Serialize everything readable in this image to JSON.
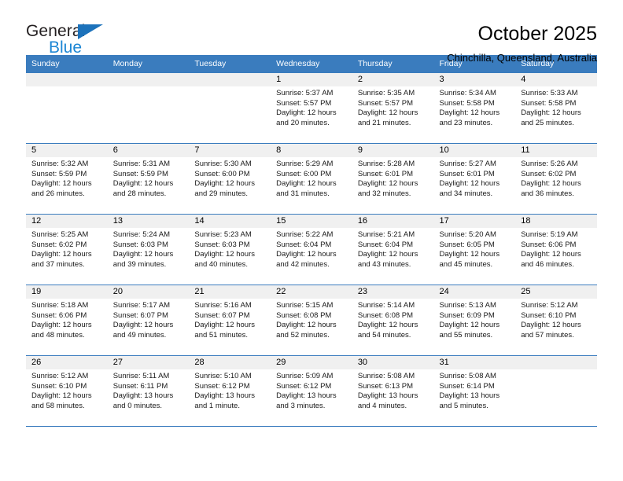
{
  "brand": {
    "name_top": "General",
    "name_bottom": "Blue",
    "color_dark": "#231f20",
    "color_blue": "#1c86d4",
    "triangle_color": "#1c72bb"
  },
  "header": {
    "title": "October 2025",
    "subtitle": "Chinchilla, Queensland, Australia"
  },
  "theme": {
    "header_row_bg": "#3a7cbe",
    "header_row_fg": "#ffffff",
    "daynum_band_bg": "#f0f0f0",
    "grid_line": "#3a7cbe"
  },
  "weekdays": [
    "Sunday",
    "Monday",
    "Tuesday",
    "Wednesday",
    "Thursday",
    "Friday",
    "Saturday"
  ],
  "weeks": [
    [
      {
        "day": "",
        "sunrise": "",
        "sunset": "",
        "daylight1": "",
        "daylight2": "",
        "empty": true
      },
      {
        "day": "",
        "sunrise": "",
        "sunset": "",
        "daylight1": "",
        "daylight2": "",
        "empty": true
      },
      {
        "day": "",
        "sunrise": "",
        "sunset": "",
        "daylight1": "",
        "daylight2": "",
        "empty": true
      },
      {
        "day": "1",
        "sunrise": "Sunrise: 5:37 AM",
        "sunset": "Sunset: 5:57 PM",
        "daylight1": "Daylight: 12 hours",
        "daylight2": "and 20 minutes."
      },
      {
        "day": "2",
        "sunrise": "Sunrise: 5:35 AM",
        "sunset": "Sunset: 5:57 PM",
        "daylight1": "Daylight: 12 hours",
        "daylight2": "and 21 minutes."
      },
      {
        "day": "3",
        "sunrise": "Sunrise: 5:34 AM",
        "sunset": "Sunset: 5:58 PM",
        "daylight1": "Daylight: 12 hours",
        "daylight2": "and 23 minutes."
      },
      {
        "day": "4",
        "sunrise": "Sunrise: 5:33 AM",
        "sunset": "Sunset: 5:58 PM",
        "daylight1": "Daylight: 12 hours",
        "daylight2": "and 25 minutes."
      }
    ],
    [
      {
        "day": "5",
        "sunrise": "Sunrise: 5:32 AM",
        "sunset": "Sunset: 5:59 PM",
        "daylight1": "Daylight: 12 hours",
        "daylight2": "and 26 minutes."
      },
      {
        "day": "6",
        "sunrise": "Sunrise: 5:31 AM",
        "sunset": "Sunset: 5:59 PM",
        "daylight1": "Daylight: 12 hours",
        "daylight2": "and 28 minutes."
      },
      {
        "day": "7",
        "sunrise": "Sunrise: 5:30 AM",
        "sunset": "Sunset: 6:00 PM",
        "daylight1": "Daylight: 12 hours",
        "daylight2": "and 29 minutes."
      },
      {
        "day": "8",
        "sunrise": "Sunrise: 5:29 AM",
        "sunset": "Sunset: 6:00 PM",
        "daylight1": "Daylight: 12 hours",
        "daylight2": "and 31 minutes."
      },
      {
        "day": "9",
        "sunrise": "Sunrise: 5:28 AM",
        "sunset": "Sunset: 6:01 PM",
        "daylight1": "Daylight: 12 hours",
        "daylight2": "and 32 minutes."
      },
      {
        "day": "10",
        "sunrise": "Sunrise: 5:27 AM",
        "sunset": "Sunset: 6:01 PM",
        "daylight1": "Daylight: 12 hours",
        "daylight2": "and 34 minutes."
      },
      {
        "day": "11",
        "sunrise": "Sunrise: 5:26 AM",
        "sunset": "Sunset: 6:02 PM",
        "daylight1": "Daylight: 12 hours",
        "daylight2": "and 36 minutes."
      }
    ],
    [
      {
        "day": "12",
        "sunrise": "Sunrise: 5:25 AM",
        "sunset": "Sunset: 6:02 PM",
        "daylight1": "Daylight: 12 hours",
        "daylight2": "and 37 minutes."
      },
      {
        "day": "13",
        "sunrise": "Sunrise: 5:24 AM",
        "sunset": "Sunset: 6:03 PM",
        "daylight1": "Daylight: 12 hours",
        "daylight2": "and 39 minutes."
      },
      {
        "day": "14",
        "sunrise": "Sunrise: 5:23 AM",
        "sunset": "Sunset: 6:03 PM",
        "daylight1": "Daylight: 12 hours",
        "daylight2": "and 40 minutes."
      },
      {
        "day": "15",
        "sunrise": "Sunrise: 5:22 AM",
        "sunset": "Sunset: 6:04 PM",
        "daylight1": "Daylight: 12 hours",
        "daylight2": "and 42 minutes."
      },
      {
        "day": "16",
        "sunrise": "Sunrise: 5:21 AM",
        "sunset": "Sunset: 6:04 PM",
        "daylight1": "Daylight: 12 hours",
        "daylight2": "and 43 minutes."
      },
      {
        "day": "17",
        "sunrise": "Sunrise: 5:20 AM",
        "sunset": "Sunset: 6:05 PM",
        "daylight1": "Daylight: 12 hours",
        "daylight2": "and 45 minutes."
      },
      {
        "day": "18",
        "sunrise": "Sunrise: 5:19 AM",
        "sunset": "Sunset: 6:06 PM",
        "daylight1": "Daylight: 12 hours",
        "daylight2": "and 46 minutes."
      }
    ],
    [
      {
        "day": "19",
        "sunrise": "Sunrise: 5:18 AM",
        "sunset": "Sunset: 6:06 PM",
        "daylight1": "Daylight: 12 hours",
        "daylight2": "and 48 minutes."
      },
      {
        "day": "20",
        "sunrise": "Sunrise: 5:17 AM",
        "sunset": "Sunset: 6:07 PM",
        "daylight1": "Daylight: 12 hours",
        "daylight2": "and 49 minutes."
      },
      {
        "day": "21",
        "sunrise": "Sunrise: 5:16 AM",
        "sunset": "Sunset: 6:07 PM",
        "daylight1": "Daylight: 12 hours",
        "daylight2": "and 51 minutes."
      },
      {
        "day": "22",
        "sunrise": "Sunrise: 5:15 AM",
        "sunset": "Sunset: 6:08 PM",
        "daylight1": "Daylight: 12 hours",
        "daylight2": "and 52 minutes."
      },
      {
        "day": "23",
        "sunrise": "Sunrise: 5:14 AM",
        "sunset": "Sunset: 6:08 PM",
        "daylight1": "Daylight: 12 hours",
        "daylight2": "and 54 minutes."
      },
      {
        "day": "24",
        "sunrise": "Sunrise: 5:13 AM",
        "sunset": "Sunset: 6:09 PM",
        "daylight1": "Daylight: 12 hours",
        "daylight2": "and 55 minutes."
      },
      {
        "day": "25",
        "sunrise": "Sunrise: 5:12 AM",
        "sunset": "Sunset: 6:10 PM",
        "daylight1": "Daylight: 12 hours",
        "daylight2": "and 57 minutes."
      }
    ],
    [
      {
        "day": "26",
        "sunrise": "Sunrise: 5:12 AM",
        "sunset": "Sunset: 6:10 PM",
        "daylight1": "Daylight: 12 hours",
        "daylight2": "and 58 minutes."
      },
      {
        "day": "27",
        "sunrise": "Sunrise: 5:11 AM",
        "sunset": "Sunset: 6:11 PM",
        "daylight1": "Daylight: 13 hours",
        "daylight2": "and 0 minutes."
      },
      {
        "day": "28",
        "sunrise": "Sunrise: 5:10 AM",
        "sunset": "Sunset: 6:12 PM",
        "daylight1": "Daylight: 13 hours",
        "daylight2": "and 1 minute."
      },
      {
        "day": "29",
        "sunrise": "Sunrise: 5:09 AM",
        "sunset": "Sunset: 6:12 PM",
        "daylight1": "Daylight: 13 hours",
        "daylight2": "and 3 minutes."
      },
      {
        "day": "30",
        "sunrise": "Sunrise: 5:08 AM",
        "sunset": "Sunset: 6:13 PM",
        "daylight1": "Daylight: 13 hours",
        "daylight2": "and 4 minutes."
      },
      {
        "day": "31",
        "sunrise": "Sunrise: 5:08 AM",
        "sunset": "Sunset: 6:14 PM",
        "daylight1": "Daylight: 13 hours",
        "daylight2": "and 5 minutes."
      },
      {
        "day": "",
        "sunrise": "",
        "sunset": "",
        "daylight1": "",
        "daylight2": "",
        "empty": true
      }
    ]
  ]
}
